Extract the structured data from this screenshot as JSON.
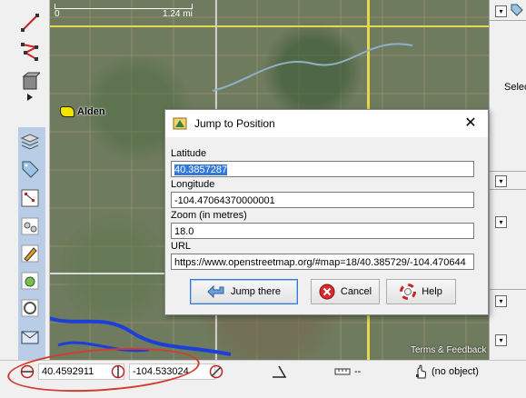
{
  "map": {
    "scale_start": "0",
    "scale_end": "1.24 mi",
    "place_label": "Alden",
    "attribution": "Terms & Feedback"
  },
  "dialog": {
    "title": "Jump to Position",
    "close_glyph": "✕",
    "latitude_label": "Latitude",
    "latitude_value": "40.3857287",
    "longitude_label": "Longitude",
    "longitude_value": "-104.47064370000001",
    "zoom_label": "Zoom (in metres)",
    "zoom_value": "18.0",
    "url_label": "URL",
    "url_value": "https://www.openstreetmap.org/#map=18/40.385729/-104.470644",
    "jump_button": "Jump there",
    "cancel_button": "Cancel",
    "help_button": "Help"
  },
  "right_panel": {
    "select_label": "Selec"
  },
  "statusbar": {
    "latitude": "40.4592911",
    "longitude": "-104.533024",
    "distance": "--",
    "object": "(no object)"
  },
  "colors": {
    "callout": "#d43a2e",
    "accent": "#3379d9",
    "road": "#e8d84a",
    "river": "#1c3fd8"
  }
}
